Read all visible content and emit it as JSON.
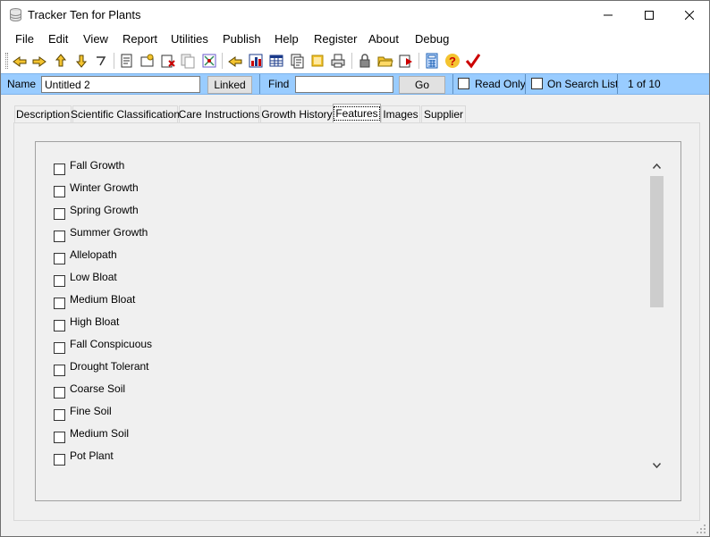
{
  "window": {
    "title": "Tracker Ten for Plants",
    "controls": {
      "minimize": "─",
      "maximize": "☐",
      "close": "✕"
    }
  },
  "menu": [
    "File",
    "Edit",
    "View",
    "Report",
    "Utilities",
    "Publish",
    "Help",
    "Register",
    "About",
    "Debug"
  ],
  "toolbar": {
    "icons": [
      "first-record-icon",
      "previous-record-icon",
      "next-record-icon",
      "last-record-icon",
      "undo-icon",
      "save-icon",
      "new-record-icon",
      "delete-record-icon",
      "copy-record-icon",
      "sort-icon",
      "search-icon",
      "chart-icon",
      "table-view-icon",
      "list-view-icon",
      "picture-icon",
      "print-icon",
      "lock-icon",
      "open-folder-icon",
      "export-icon",
      "calculator-icon",
      "help-icon",
      "checkmark-icon"
    ]
  },
  "record_bar": {
    "name_label": "Name",
    "name_value": "Untitled 2",
    "linked_label": "Linked",
    "find_label": "Find",
    "find_value": "",
    "go_label": "Go",
    "read_only_label": "Read Only",
    "on_search_list_label": "On Search List",
    "record_position": "1 of 10"
  },
  "tabs": [
    {
      "label": "Description",
      "active": false
    },
    {
      "label": "Scientific Classification",
      "active": false
    },
    {
      "label": "Care Instructions",
      "active": false
    },
    {
      "label": "Growth History",
      "active": false
    },
    {
      "label": "Features",
      "active": true
    },
    {
      "label": "Images",
      "active": false
    },
    {
      "label": "Supplier",
      "active": false
    }
  ],
  "features": [
    {
      "label": "Fall Growth",
      "checked": false
    },
    {
      "label": "Winter Growth",
      "checked": false
    },
    {
      "label": "Spring Growth",
      "checked": false
    },
    {
      "label": "Summer Growth",
      "checked": false
    },
    {
      "label": "Allelopath",
      "checked": false
    },
    {
      "label": "Low Bloat",
      "checked": false
    },
    {
      "label": "Medium Bloat",
      "checked": false
    },
    {
      "label": "High Bloat",
      "checked": false
    },
    {
      "label": "Fall Conspicuous",
      "checked": false
    },
    {
      "label": "Drought Tolerant",
      "checked": false
    },
    {
      "label": "Coarse Soil",
      "checked": false
    },
    {
      "label": "Fine Soil",
      "checked": false
    },
    {
      "label": "Medium Soil",
      "checked": false
    },
    {
      "label": "Pot Plant",
      "checked": false
    }
  ],
  "colors": {
    "record_bar": "#99ccff",
    "window_bg": "#f0f0f0",
    "check_accent": "#cc0000"
  }
}
